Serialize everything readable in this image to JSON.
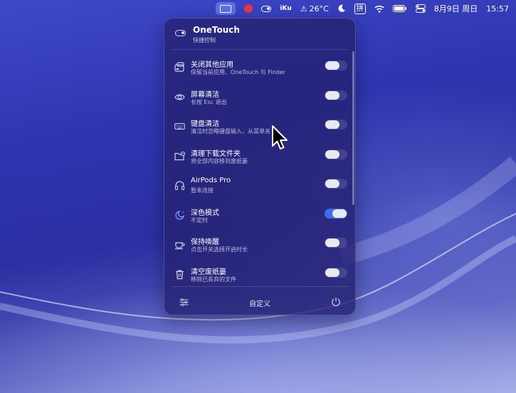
{
  "menubar": {
    "items": [
      {
        "name": "onetouch-menubar-icon"
      },
      {
        "name": "record-dot-icon"
      },
      {
        "name": "toggle-icon"
      },
      {
        "name": "iku-icon",
        "label": "iKu"
      },
      {
        "name": "weather-icon",
        "label": "26°C"
      },
      {
        "name": "moon-icon"
      },
      {
        "name": "input-method-icon",
        "label": "拼"
      },
      {
        "name": "wifi-icon"
      },
      {
        "name": "battery-icon"
      },
      {
        "name": "control-center-icon"
      }
    ],
    "date": "8月9日 周日",
    "time": "15:57"
  },
  "panel": {
    "title": "OneTouch",
    "subtitle": "快捷控制",
    "items": [
      {
        "icon": "close-apps-icon",
        "title": "关闭其他应用",
        "subtitle": "保留当前应用、OneTouch 与 Finder",
        "on": false
      },
      {
        "icon": "eye-icon",
        "title": "屏幕清洁",
        "subtitle": "长按 Esc 退出",
        "on": false
      },
      {
        "icon": "keyboard-icon",
        "title": "键盘清洁",
        "subtitle": "清洁时忽略键盘输入，从菜单关",
        "on": false
      },
      {
        "icon": "folder-icon",
        "title": "清理下载文件夹",
        "subtitle": "将全部内容移到废纸篓",
        "on": false
      },
      {
        "icon": "headphones-icon",
        "title": "AirPods Pro",
        "subtitle": "暂未连接",
        "on": false
      },
      {
        "icon": "dark-mode-icon",
        "title": "深色模式",
        "subtitle": "不定时",
        "on": true
      },
      {
        "icon": "coffee-icon",
        "title": "保持唤醒",
        "subtitle": "点击开关选择开启时长",
        "on": false
      },
      {
        "icon": "trash-icon",
        "title": "清空废纸篓",
        "subtitle": "移除已丢弃的文件",
        "on": false
      }
    ],
    "footer": {
      "label": "自定义"
    }
  },
  "colors": {
    "accent": "#3b6fe6",
    "panel_bg": "#26227a",
    "record": "#e8344a"
  }
}
